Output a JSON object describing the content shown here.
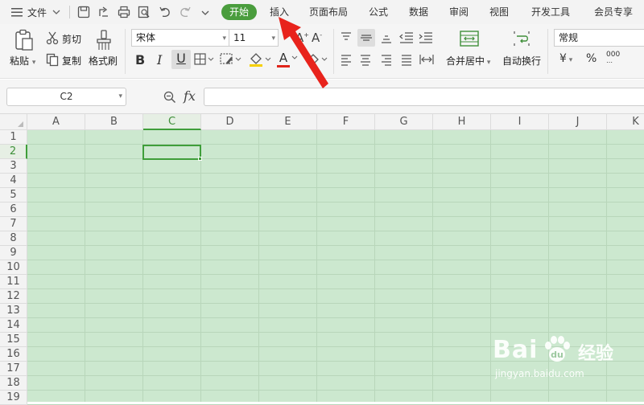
{
  "titlebar": {
    "menu_label": "文件",
    "tabs": [
      "开始",
      "插入",
      "页面布局",
      "公式",
      "数据",
      "审阅",
      "视图",
      "开发工具",
      "会员专享"
    ]
  },
  "ribbon": {
    "paste_label": "粘贴",
    "cut_label": "剪切",
    "copy_label": "复制",
    "format_painter_label": "格式刷",
    "font_name": "宋体",
    "font_size": "11",
    "merge_center_label": "合并居中",
    "wrap_text_label": "自动换行",
    "number_format": "常规",
    "currency_symbol": "¥",
    "percent_symbol": "%",
    "thousands_label": "000",
    "bold_label": "B",
    "italic_label": "I",
    "underline_label": "U",
    "font_color_label": "A"
  },
  "formula_bar": {
    "name_box": "C2",
    "fx_label": "fx",
    "formula": ""
  },
  "sheet": {
    "columns": [
      "A",
      "B",
      "C",
      "D",
      "E",
      "F",
      "G",
      "H",
      "I",
      "J",
      "K"
    ],
    "rows": [
      "1",
      "2",
      "3",
      "4",
      "5",
      "6",
      "7",
      "8",
      "9",
      "10",
      "11",
      "12",
      "13",
      "14",
      "15",
      "16",
      "17",
      "18",
      "19"
    ],
    "selected_cell": "C2",
    "grid_color": "#cce8cf",
    "accent": "#4a9d3d"
  },
  "annotation": {
    "arrow_color": "#e8231c",
    "points_to": "插入"
  },
  "watermark": {
    "brand": "Bai",
    "brand_suffix": "经验",
    "url": "jingyan.baidu.com"
  }
}
